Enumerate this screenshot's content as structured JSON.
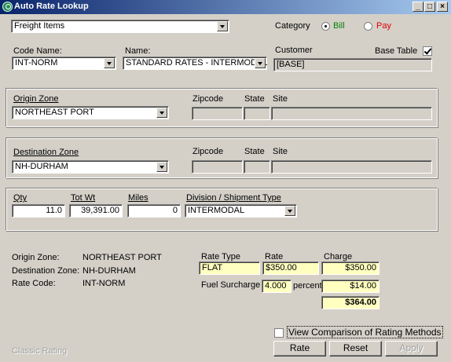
{
  "window": {
    "title": "Auto Rate Lookup"
  },
  "top": {
    "item_type": "Freight Items",
    "category_label": "Category",
    "bill_label": "Bill",
    "pay_label": "Pay",
    "bill_color": "#008000",
    "pay_color": "#e00000"
  },
  "codes": {
    "code_name_label": "Code Name:",
    "code_name_value": "INT-NORM",
    "name_label": "Name:",
    "name_value": "STANDARD RATES - INTERMODAL",
    "customer_label": "Customer",
    "customer_value": "[BASE]",
    "base_table_label": "Base Table"
  },
  "origin": {
    "zone_label": "Origin Zone",
    "zone_value": "NORTHEAST PORT",
    "zipcode_label": "Zipcode",
    "state_label": "State",
    "site_label": "Site"
  },
  "destination": {
    "zone_label": "Destination Zone",
    "zone_value": "NH-DURHAM",
    "zipcode_label": "Zipcode",
    "state_label": "State",
    "site_label": "Site"
  },
  "shipment": {
    "qty_label": "Qty",
    "qty_value": "11.0",
    "totwt_label": "Tot Wt",
    "totwt_value": "39,391.00",
    "miles_label": "Miles",
    "miles_value": "0",
    "division_label": "Division / Shipment Type",
    "division_value": "INTERMODAL"
  },
  "summary": {
    "origin_label": "Origin Zone:",
    "origin_value": "NORTHEAST PORT",
    "destination_label": "Destination Zone:",
    "destination_value": "NH-DURHAM",
    "rate_code_label": "Rate Code:",
    "rate_code_value": "INT-NORM"
  },
  "rates": {
    "rate_type_header": "Rate Type",
    "rate_header": "Rate",
    "charge_header": "Charge",
    "rate_type_value": "FLAT",
    "rate_value": "$350.00",
    "charge_value": "$350.00",
    "fuel_label": "Fuel Surcharge",
    "fuel_value": "4.000",
    "percent_label": "percent",
    "fuel_charge": "$14.00",
    "total": "$364.00"
  },
  "footer": {
    "classic_label": "Classic Rating",
    "compare_label": "View Comparison of Rating Methods",
    "rate_button": "Rate",
    "reset_button": "Reset",
    "apply_button": "Apply"
  }
}
